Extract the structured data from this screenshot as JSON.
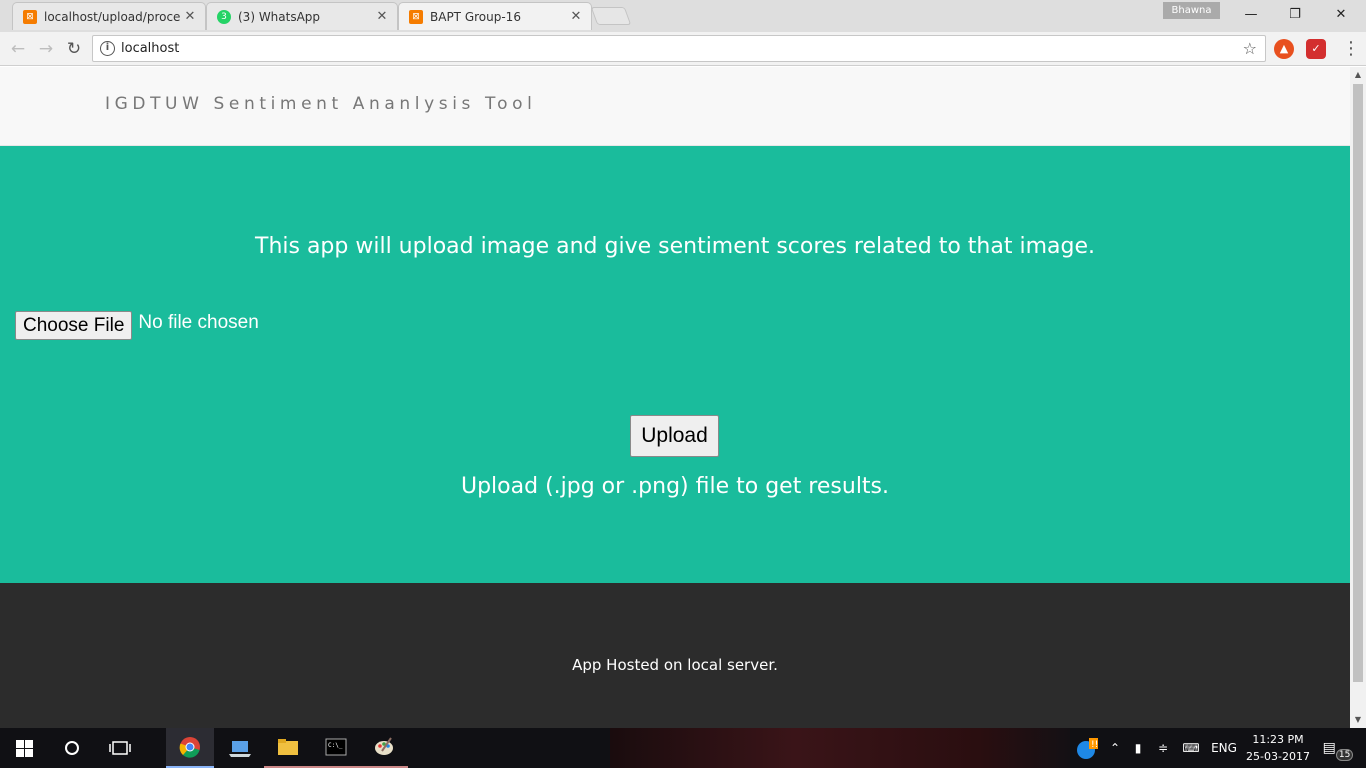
{
  "browser": {
    "tabs": [
      {
        "title": "localhost/upload/process",
        "favicon": "xampp-icon",
        "active": false
      },
      {
        "title": "(3) WhatsApp",
        "favicon": "whatsapp-icon",
        "badge": "3",
        "active": false
      },
      {
        "title": "BAPT Group-16",
        "favicon": "xampp-icon",
        "active": true
      }
    ],
    "profile_name": "Bhawna",
    "url": "localhost"
  },
  "site": {
    "brand": "IGDTUW Sentiment Ananlysis Tool",
    "intro": "This app will upload image and give sentiment scores related to that image.",
    "choose_file_label": "Choose File",
    "file_status": "No file chosen",
    "upload_label": "Upload",
    "hint": "Upload (.jpg or .png) file to get results.",
    "footer": "App Hosted on local server."
  },
  "taskbar": {
    "language": "ENG",
    "time": "11:23 PM",
    "date": "25-03-2017",
    "notification_count": "15"
  },
  "colors": {
    "hero": "#1abc9c",
    "footer": "#2c2c2c",
    "header": "#f8f8f8"
  }
}
